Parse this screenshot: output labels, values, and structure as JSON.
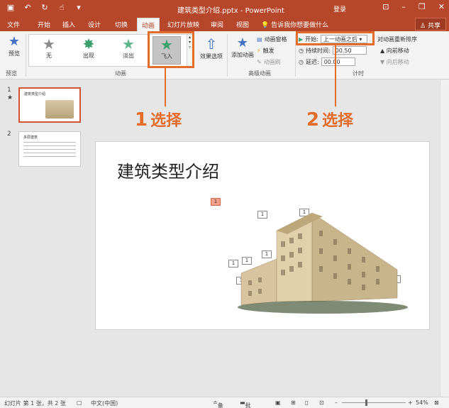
{
  "app": {
    "doc_title": "建筑类型介绍.pptx - PowerPoint",
    "login": "登录",
    "qat_icons": [
      "save-icon",
      "undo-icon",
      "redo-icon",
      "touch-mode-icon",
      "customize-icon"
    ],
    "window_icons": [
      "ribbon-display-icon",
      "minimize-icon",
      "restore-icon",
      "close-icon"
    ]
  },
  "tabs": [
    "文件",
    "开始",
    "插入",
    "设计",
    "切换",
    "动画",
    "幻灯片放映",
    "审阅",
    "视图"
  ],
  "active_tab": "动画",
  "tellme": "告诉我你想要做什么",
  "share": "共享",
  "ribbon": {
    "preview_label": "预览",
    "preview_group": "预览",
    "animation_group": "动画",
    "gallery": [
      "无",
      "出现",
      "淡出",
      "飞入"
    ],
    "selected_animation": "飞入",
    "effect_options": "效果选项",
    "advanced_group": "高级动画",
    "add_animation": "添加动画",
    "animation_pane": "动画窗格",
    "trigger": "触发",
    "animation_painter": "动画刷",
    "timing_group": "计时",
    "start_label": "开始:",
    "start_value": "上一动画之后",
    "duration_label": "持续时间:",
    "duration_value": "00.50",
    "delay_label": "延迟:",
    "delay_value": "00.00",
    "reorder_title": "对动画重新排序",
    "move_earlier": "向前移动",
    "move_later": "向后移动"
  },
  "thumbnails": [
    {
      "num": "1",
      "marker": "★",
      "title": "建筑类型介绍"
    },
    {
      "num": "2",
      "marker": "",
      "title": "多层建筑"
    }
  ],
  "slide": {
    "title": "建筑类型介绍",
    "tags": [
      "1",
      "1",
      "1",
      "1",
      "1",
      "1",
      "1",
      "1"
    ]
  },
  "annotations": {
    "step1_num": "1",
    "step1_text": "选择",
    "step2_num": "2",
    "step2_text": "选择"
  },
  "status": {
    "slide_info": "幻灯片 第 1 张，共 2 张",
    "language": "中文(中国)",
    "notes": "备注",
    "comments": "批注",
    "zoom": "54%"
  },
  "colors": {
    "brand": "#b7472a",
    "highlight": "#e36c2a"
  }
}
